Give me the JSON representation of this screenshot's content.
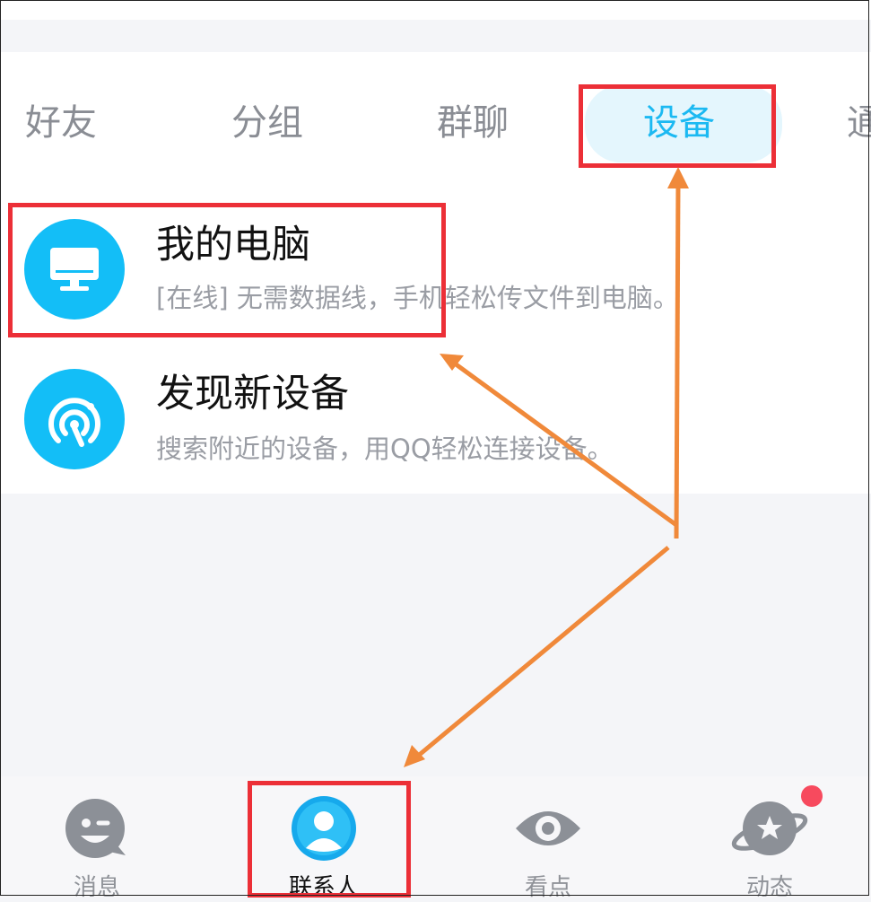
{
  "tabs": [
    {
      "label": "好友",
      "active": false
    },
    {
      "label": "分组",
      "active": false
    },
    {
      "label": "群聊",
      "active": false
    },
    {
      "label": "设备",
      "active": true
    },
    {
      "label": "通",
      "active": false
    }
  ],
  "devices": [
    {
      "title": "我的电脑",
      "subtitle": "[在线] 无需数据线，手机轻松传文件到电脑。",
      "icon": "monitor-icon"
    },
    {
      "title": "发现新设备",
      "subtitle": "搜索附近的设备，用QQ轻松连接设备。",
      "icon": "radar-icon"
    }
  ],
  "bottom_nav": [
    {
      "label": "消息",
      "icon": "message-smile-icon",
      "active": false
    },
    {
      "label": "联系人",
      "icon": "contacts-person-icon",
      "active": true
    },
    {
      "label": "看点",
      "icon": "eye-icon",
      "active": false
    },
    {
      "label": "动态",
      "icon": "planet-star-icon",
      "active": false,
      "badge": true
    }
  ],
  "colors": {
    "accent": "#1bb9f2",
    "highlight_box": "#ec2f37",
    "arrow": "#f0893a",
    "badge": "#f74a5e"
  }
}
